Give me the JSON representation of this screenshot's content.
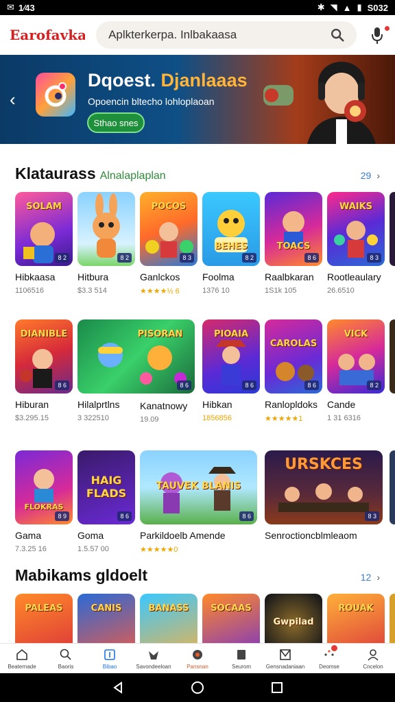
{
  "status_bar": {
    "left_text": "1⁄43",
    "time": "S032"
  },
  "header": {
    "brand": "Earofavkaces",
    "search_value": "Aplkterkerpa. Inlbakaasa",
    "search_placeholder": "Aplkterkerpa. Inlbakaasa"
  },
  "banner": {
    "title_part1": "Dqoest.",
    "title_part2": "Djanlaaas",
    "subtitle": "Opoencin bltecho lohloplaoan",
    "cta": "Sthao snes"
  },
  "sections": [
    {
      "title": "Klataurass",
      "subtitle": "Alnalaplaplan",
      "count": "29",
      "arrow": "›"
    },
    {
      "title": "Mabikams gldoelt",
      "subtitle": "",
      "count": "12",
      "arrow": "›"
    }
  ],
  "row1": [
    {
      "name": "Hibkaasa",
      "meta": "1106516",
      "thumb_text": "SOLAM"
    },
    {
      "name": "Hitbura",
      "meta": "$3.3 514",
      "thumb_text": ""
    },
    {
      "name": "Ganlckos",
      "meta": "★★★★½ 6",
      "thumb_text": "POCOS"
    },
    {
      "name": "Foolma",
      "meta": "1376 10",
      "thumb_text": "BEHES"
    },
    {
      "name": "Raalbkaran",
      "meta": "1S1k 105",
      "thumb_text": "TOACS"
    },
    {
      "name": "Rootleaulary",
      "meta": "26.6510",
      "thumb_text": "WAIKS"
    }
  ],
  "row2": [
    {
      "name": "Hiburan",
      "meta": "$3.295.15",
      "thumb_text": "DIANIBLE"
    },
    {
      "name": "Hilalprtlns",
      "meta": "3 322510",
      "thumb_text": "PISORAN"
    },
    {
      "name": "Kanatnowy",
      "meta": "19.09",
      "thumb_text": ""
    },
    {
      "name": "Hibkan",
      "meta": "1856856",
      "thumb_text": "PIOAIA"
    },
    {
      "name": "Ranlopldoks",
      "meta": "★★★★★1",
      "thumb_text": "CAROLAS"
    },
    {
      "name": "Cande",
      "meta": "1 31 6316",
      "thumb_text": "VICK"
    }
  ],
  "row3": [
    {
      "name": "Gama",
      "meta": "7.3.25 16",
      "thumb_text": "FLOKRAS"
    },
    {
      "name": "Goma",
      "meta": "1.5.57 00",
      "thumb_text": "HAIG FLADS"
    },
    {
      "name": "Parkildoelb Amende",
      "meta": "★★★★★0",
      "thumb_text": "TAUVEK BLANIS"
    },
    {
      "name": "Senroctioncblmleaom",
      "meta": "",
      "thumb_text": "URSKCES"
    }
  ],
  "row4": [
    {
      "thumb_text": "PALEAS"
    },
    {
      "thumb_text": "CANIS"
    },
    {
      "thumb_text": "BANASS"
    },
    {
      "thumb_text": "SOCAAS"
    },
    {
      "thumb_text": "Gwpilad"
    },
    {
      "thumb_text": "ROUAK"
    }
  ],
  "bottom_nav": [
    {
      "label": "Beaternade",
      "icon": "home-icon"
    },
    {
      "label": "Baoris",
      "icon": "search-icon"
    },
    {
      "label": "Bibao",
      "icon": "apps-icon"
    },
    {
      "label": "Savondeeloan",
      "icon": "games-icon"
    },
    {
      "label": "Pansnan",
      "icon": "media-icon"
    },
    {
      "label": "Seurom",
      "icon": "books-icon"
    },
    {
      "label": "Gensnadaniaan",
      "icon": "library-icon"
    },
    {
      "label": "Deomse",
      "icon": "more-icon"
    },
    {
      "label": "Cncelon",
      "icon": "account-icon"
    }
  ],
  "colors": {
    "brand": "#d32020",
    "accent": "#1a73e8",
    "cta": "#1e8f3a"
  }
}
